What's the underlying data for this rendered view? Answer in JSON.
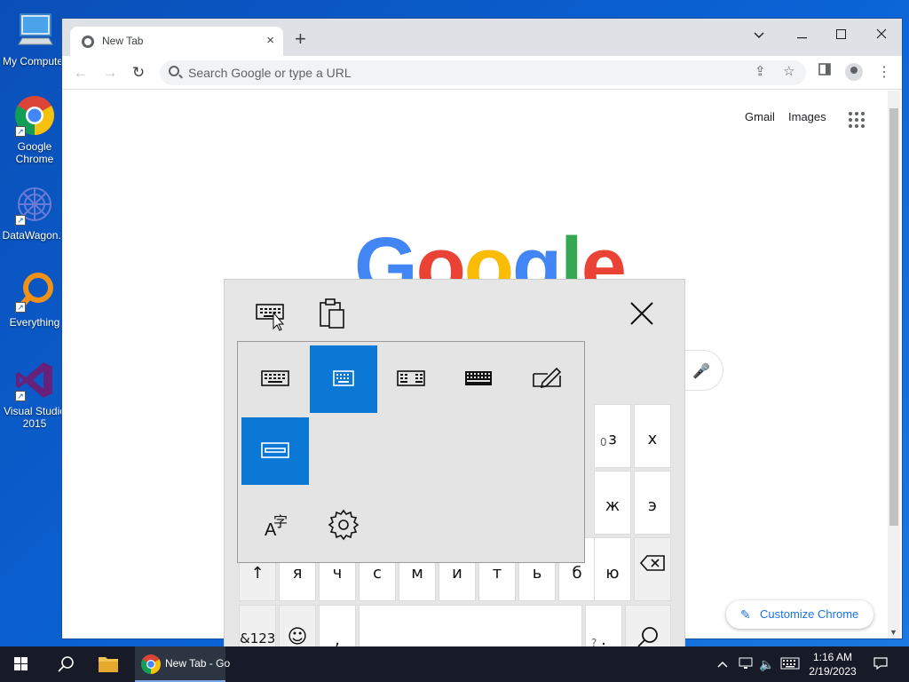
{
  "desktop": {
    "icons": [
      {
        "label": "My Computer"
      },
      {
        "label": "Google Chrome"
      },
      {
        "label": "DataWagon..."
      },
      {
        "label": "Everything"
      },
      {
        "label": "Visual Studio 2015"
      }
    ]
  },
  "browser": {
    "tab_title": "New Tab",
    "tab_close": "×",
    "new_tab": "+",
    "omnibox_placeholder": "Search Google or type a URL",
    "links": {
      "gmail": "Gmail",
      "images": "Images"
    },
    "logo_letters": [
      "G",
      "o",
      "o",
      "g",
      "l",
      "e"
    ],
    "customize_label": "Customize Chrome",
    "colors": {
      "blue": "#4285f4",
      "red": "#ea4335",
      "yellow": "#fbbc05",
      "green": "#34a853",
      "accent": "#1a73e8"
    }
  },
  "touch_keyboard": {
    "selected_color": "#0a78d4",
    "layout_options": [
      {
        "icon": "keyboard-default-icon",
        "selected": false
      },
      {
        "icon": "keyboard-small-icon",
        "selected": true
      },
      {
        "icon": "keyboard-split-icon",
        "selected": false
      },
      {
        "icon": "keyboard-standard-icon",
        "selected": false
      },
      {
        "icon": "handwriting-icon",
        "selected": false
      },
      {
        "icon": "one-handed-keyboard-icon",
        "selected": true
      }
    ],
    "keys": {
      "row1_hint": "0",
      "row1": [
        "з",
        "х"
      ],
      "row2": [
        "ж",
        "э"
      ],
      "row3": [
        "↑",
        "я",
        "ч",
        "с",
        "м",
        "и",
        "т",
        "ь",
        "б",
        "ю"
      ],
      "row4_left": "&123",
      "row4_comma": ",",
      "row4_dot": ".",
      "row4_dot_hint": "?"
    }
  },
  "taskbar": {
    "chrome_label": "New Tab - Go",
    "time": "1:16 AM",
    "date": "2/19/2023"
  }
}
